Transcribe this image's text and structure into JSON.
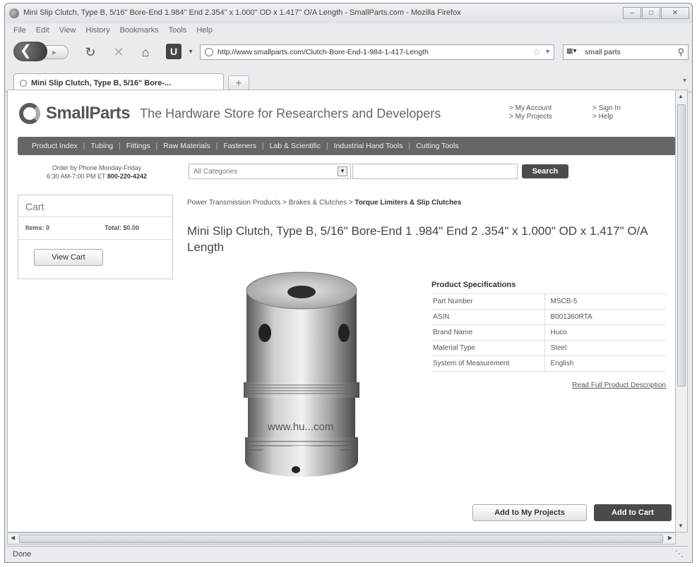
{
  "window": {
    "title": "Mini Slip Clutch, Type B, 5/16\" Bore-End 1.984\" End 2.354\" x 1.000\" OD x 1.417\" O/A Length - SmallParts.com - Mozilla Firefox",
    "buttons": [
      "–",
      "□",
      "✕"
    ]
  },
  "menubar": [
    "File",
    "Edit",
    "View",
    "History",
    "Bookmarks",
    "Tools",
    "Help"
  ],
  "navbar": {
    "url": "http://www.smallparts.com/Clutch-Bore-End-1-984-1-417-Length",
    "search_query": "small parts"
  },
  "tab": {
    "label": "Mini Slip Clutch, Type B, 5/16\" Bore-..."
  },
  "site": {
    "brand": "SmallParts",
    "tagline": "The Hardware Store for Researchers and Developers",
    "account_links": [
      "> My Account",
      "> My Projects"
    ],
    "help_links": [
      "> Sign In",
      "> Help"
    ],
    "nav": [
      "Product Index",
      "Tubing",
      "Fittings",
      "Raw Materials",
      "Fasteners",
      "Lab & Scientific",
      "Industrial Hand Tools",
      "Cutting Tools"
    ],
    "phone_line1": "Order by Phone Monday-Friday",
    "phone_line2": "6:30 AM-7:00 PM ET",
    "phone_number": "800-220-4242",
    "category_value": "All Categories",
    "search_button": "Search"
  },
  "cart": {
    "title": "Cart",
    "items": "Items: 0",
    "total": "Total: $0.00",
    "view_button": "View Cart"
  },
  "breadcrumb": {
    "parts": [
      "Power Transmission Products",
      "Brakes & Clutches"
    ],
    "current": "Torque Limiters & Slip Clutches",
    "separator": " > "
  },
  "product": {
    "title": "Mini Slip Clutch, Type B, 5/16\" Bore-End 1 .984\" End 2 .354\" x 1.000\" OD x 1.417\" O/A Length",
    "image_text": "www.hu...com"
  },
  "specs": {
    "title": "Product Specifications",
    "rows": [
      {
        "key": "Part Number",
        "value": "MSCB-5"
      },
      {
        "key": "ASIN",
        "value": "B001360RTA"
      },
      {
        "key": "Brand Name",
        "value": "Huco"
      },
      {
        "key": "Material Type",
        "value": "Steel"
      },
      {
        "key": "System of Measurement",
        "value": "English"
      }
    ],
    "full_desc_link": "Read Full Product Description"
  },
  "actions": {
    "add_projects": "Add to My Projects",
    "add_cart": "Add to Cart"
  },
  "status": "Done"
}
